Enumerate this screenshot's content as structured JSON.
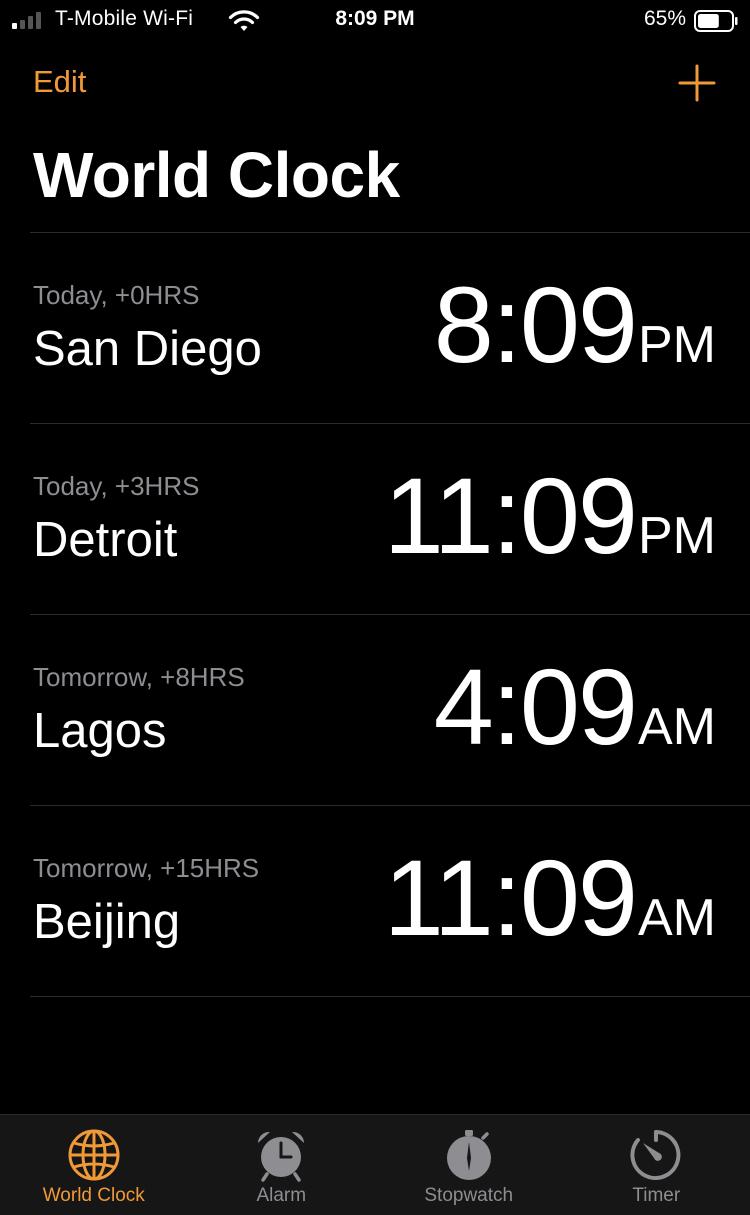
{
  "status_bar": {
    "carrier": "T-Mobile Wi-Fi",
    "time": "8:09 PM",
    "battery_percent": "65%",
    "signal_bars_filled": 1,
    "signal_bars_total": 4,
    "battery_level": 0.65
  },
  "nav": {
    "edit_label": "Edit",
    "add_icon": "plus-icon",
    "title": "World Clock"
  },
  "clocks": [
    {
      "offset": "Today, +0HRS",
      "city": "San Diego",
      "time": "8:09",
      "ampm": "PM"
    },
    {
      "offset": "Today, +3HRS",
      "city": "Detroit",
      "time": "11:09",
      "ampm": "PM"
    },
    {
      "offset": "Tomorrow, +8HRS",
      "city": "Lagos",
      "time": "4:09",
      "ampm": "AM"
    },
    {
      "offset": "Tomorrow, +15HRS",
      "city": "Beijing",
      "time": "11:09",
      "ampm": "AM"
    }
  ],
  "tabs": [
    {
      "label": "World Clock",
      "icon": "globe-icon",
      "active": true
    },
    {
      "label": "Alarm",
      "icon": "alarm-clock-icon",
      "active": false
    },
    {
      "label": "Stopwatch",
      "icon": "stopwatch-icon",
      "active": false
    },
    {
      "label": "Timer",
      "icon": "timer-icon",
      "active": false
    }
  ],
  "colors": {
    "accent": "#f09a37",
    "background": "#000000",
    "secondary_text": "#8d8d92",
    "inactive_icon": "#8d8d92"
  }
}
